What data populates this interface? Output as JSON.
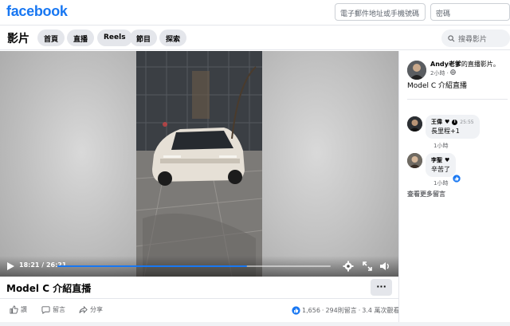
{
  "header": {
    "logo": "facebook",
    "email_placeholder": "電子郵件地址或手機號碼",
    "password_placeholder": "密碼"
  },
  "subnav": {
    "title": "影片",
    "tabs": [
      "首頁",
      "直播",
      "Reels",
      "節目",
      "探索"
    ],
    "search_placeholder": "搜尋影片"
  },
  "player": {
    "time": "18:21 / 26:21",
    "progress": 0.695,
    "colors": {
      "accent": "#1877f2"
    }
  },
  "video": {
    "title": "Model C 介紹直播",
    "more_label": "···"
  },
  "actions": {
    "like": "讚",
    "comment": "留言",
    "share": "分享",
    "reaction_count": "1,656",
    "comments_count": "294則留言",
    "separator": "·",
    "views": "3.4 萬次觀看"
  },
  "sidebar": {
    "poster_name": "Andy老爹",
    "poster_suffix": "的直播影片。",
    "poster_time": "2小時 ·",
    "post_text": "Model C 介紹直播",
    "comments": [
      {
        "name": "王偉",
        "timestamp": "25:55",
        "text": "長里程+1",
        "time": "1小時"
      },
      {
        "name": "李聖",
        "timestamp": "",
        "text": "辛苦了",
        "time": "1小時"
      }
    ],
    "more_comments": "查看更多留言"
  }
}
